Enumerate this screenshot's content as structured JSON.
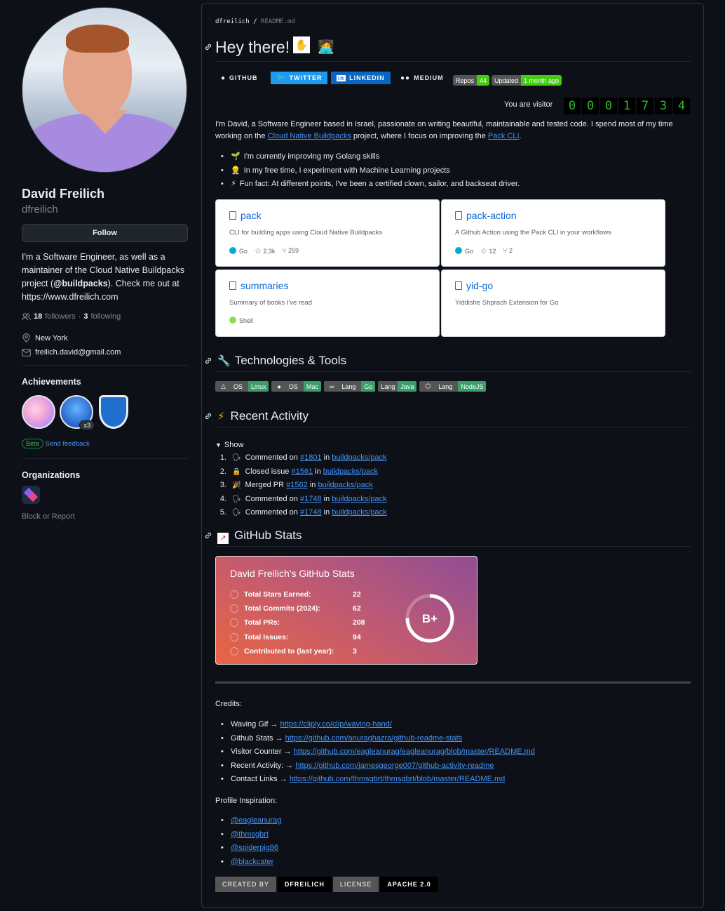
{
  "profile": {
    "name": "David Freilich",
    "username": "dfreilich",
    "follow_label": "Follow",
    "bio_1": "I'm a Software Engineer, as well as a maintainer of the Cloud Native Buildpacks project (",
    "bio_bold": "@buildpacks",
    "bio_2": "). Check me out at https://www.dfreilich.com",
    "followers_count": "18",
    "followers_label": "followers",
    "separator": "·",
    "following_count": "3",
    "following_label": "following",
    "location": "New York",
    "email": "freilich.david@gmail.com",
    "achievements_title": "Achievements",
    "achievement_multiplier": "x3",
    "beta_label": "Beta",
    "feedback_label": "Send feedback",
    "organizations_title": "Organizations",
    "block_label": "Block or Report"
  },
  "readme": {
    "crumb_user": "dfreilich",
    "crumb_sep": "/",
    "crumb_file": "README.md",
    "title": "Hey there!",
    "badges": {
      "github": "GITHUB",
      "twitter": "TWITTER",
      "linkedin": "LINKEDIN",
      "medium": "MEDIUM",
      "repos_label": "Repos",
      "repos_value": "44",
      "updated_label": "Updated",
      "updated_value": "1 month ago"
    },
    "visitor_label": "You are visitor",
    "visitor_digits": [
      "0",
      "0",
      "0",
      "1",
      "7",
      "3",
      "4"
    ],
    "intro_1": "I'm David, a Software Engineer based in Israel, passionate on writing beautiful, maintainable and tested code. I spend most of my time working on the ",
    "intro_link_1": "Cloud Native Buildpacks",
    "intro_2": " project, where I focus on improving the ",
    "intro_link_2": "Pack CLI",
    "intro_3": ".",
    "bullets": [
      {
        "emoji": "🌱",
        "text": "I'm currently improving my Golang skills"
      },
      {
        "emoji": "👷",
        "text": "In my free time, I experiment with Machine Learning projects"
      },
      {
        "emoji": "⚡",
        "text": "Fun fact: At different points, I've been a certified clown, sailor, and backseat driver."
      }
    ],
    "repos": [
      {
        "name": "pack",
        "desc": "CLI for building apps using Cloud Native Buildpacks",
        "lang": "Go",
        "lang_color": "#00ADD8",
        "stars": "2.3k",
        "forks": "259"
      },
      {
        "name": "pack-action",
        "desc": "A Github Action using the Pack CLI in your workflows",
        "lang": "Go",
        "lang_color": "#00ADD8",
        "stars": "12",
        "forks": "2"
      },
      {
        "name": "summaries",
        "desc": "Summary of books I've read",
        "lang": "Shell",
        "lang_color": "#89e051"
      },
      {
        "name": "yid-go",
        "desc": "Yiddishe Shprach Extension for Go"
      }
    ],
    "tech_title": "Technologies & Tools",
    "tech_badges": [
      {
        "label": "OS",
        "value": "Linux",
        "icon": "linux-icon"
      },
      {
        "label": "OS",
        "value": "Mac",
        "icon": "apple-icon"
      },
      {
        "label": "Lang",
        "value": "Go",
        "icon": "go-icon"
      },
      {
        "label": "Lang",
        "value": "Java",
        "icon": ""
      },
      {
        "label": "Lang",
        "value": "NodeJS",
        "icon": "nodejs-icon"
      }
    ],
    "activity_title": "Recent Activity",
    "activity_summary": "Show",
    "activity": [
      {
        "num": "1.",
        "emoji": "🗣",
        "action": "Commented on",
        "issue": "#1801",
        "in": "in",
        "repo": "buildpacks/pack"
      },
      {
        "num": "2.",
        "emoji": "🔒",
        "action": "Closed issue",
        "issue": "#1561",
        "in": "in",
        "repo": "buildpacks/pack"
      },
      {
        "num": "3.",
        "emoji": "🎉",
        "action": "Merged PR",
        "issue": "#1562",
        "in": "in",
        "repo": "buildpacks/pack"
      },
      {
        "num": "4.",
        "emoji": "🗣",
        "action": "Commented on",
        "issue": "#1748",
        "in": "in",
        "repo": "buildpacks/pack"
      },
      {
        "num": "5.",
        "emoji": "🗣",
        "action": "Commented on",
        "issue": "#1748",
        "in": "in",
        "repo": "buildpacks/pack"
      }
    ],
    "stats_title": "GitHub Stats",
    "stats_card": {
      "title": "David Freilich's GitHub Stats",
      "rows": [
        {
          "label": "Total Stars Earned:",
          "value": "22"
        },
        {
          "label": "Total Commits (2024):",
          "value": "62"
        },
        {
          "label": "Total PRs:",
          "value": "208"
        },
        {
          "label": "Total Issues:",
          "value": "94"
        },
        {
          "label": "Contributed to (last year):",
          "value": "3"
        }
      ],
      "grade": "B+",
      "grade_progress": 0.75
    },
    "credits_title": "Credits:",
    "credits": [
      {
        "label": "Waving Gif →",
        "url": "https://cliply.co/clip/waving-hand/"
      },
      {
        "label": "Github Stats →",
        "url": "https://github.com/anuraghazra/github-readme-stats"
      },
      {
        "label": "Visitor Counter →",
        "url": "https://github.com/eagleanurag/eagleanurag/blob/master/README.md"
      },
      {
        "label": "Recent Activity: →",
        "url": "https://github.com/jamesgeorge007/github-activity-readme"
      },
      {
        "label": "Contact Links →",
        "url": "https://github.com/thmsgbrt/thmsgbrt/blob/master/README.md"
      }
    ],
    "inspiration_title": "Profile Inspiration:",
    "inspiration": [
      "@eagleanurag",
      "@thmsgbrt",
      "@spiderpig86",
      "@blackcater"
    ],
    "footer": {
      "created_by_label": "CREATED BY",
      "created_by_value": "DFREILICH",
      "license_label": "LICENSE",
      "license_value": "APACHE 2.0"
    }
  }
}
